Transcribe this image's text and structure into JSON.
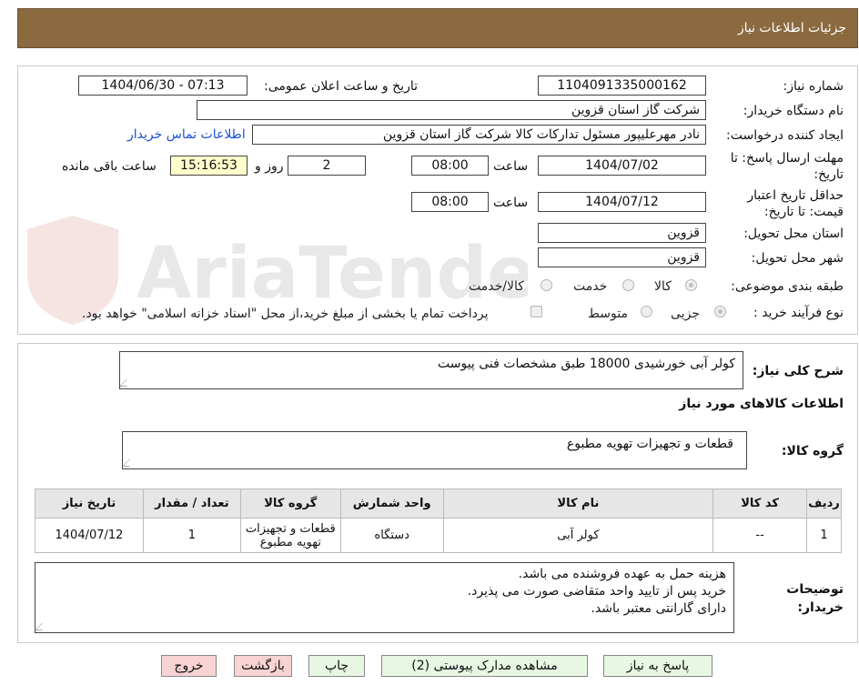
{
  "header": {
    "title": "جزئیات اطلاعات نیاز"
  },
  "watermark": "AriaTender.neT",
  "form": {
    "need_number_label": "شماره نیاز:",
    "need_number": "1104091335000162",
    "announce_label": "تاریخ و ساعت اعلان عمومی:",
    "announce_value": "1404/06/30 - 07:13",
    "buyer_org_label": "نام دستگاه خریدار:",
    "buyer_org": "شرکت گاز استان قزوین",
    "creator_label": "ایجاد کننده درخواست:",
    "creator": "نادر مهرعلیپور مسئول تدارکات کالا شرکت گاز استان قزوین",
    "contact_link": "اطلاعات تماس خریدار",
    "deadline_label": "مهلت ارسال پاسخ: تا تاریخ:",
    "deadline_date": "1404/07/02",
    "time_label": "ساعت",
    "deadline_time": "08:00",
    "days_value": "2",
    "days_label": "روز و",
    "remaining_time": "15:16:53",
    "remaining_label": "ساعت باقی مانده",
    "validity_label": "حداقل تاریخ اعتبار قیمت: تا تاریخ:",
    "validity_date": "1404/07/12",
    "validity_time": "08:00",
    "province_label": "استان محل تحویل:",
    "province": "قزوین",
    "city_label": "شهر محل تحویل:",
    "city": "قزوین",
    "category_label": "طبقه بندی موضوعی:",
    "category_options": [
      "کالا",
      "خدمت",
      "کالا/خدمت"
    ],
    "process_label": "نوع فرآیند خرید :",
    "process_options": [
      "جزیی",
      "متوسط"
    ],
    "payment_note": "پرداخت تمام یا بخشی از مبلغ خرید،از محل \"اسناد خزانه اسلامی\" خواهد بود."
  },
  "details": {
    "summary_label": "شرح کلی نیاز:",
    "summary": "کولر آبی خورشیدی 18000 طبق مشخصات فنی پیوست",
    "goods_info_title": "اطلاعات کالاهای مورد نیاز",
    "goods_group_label": "گروه کالا:",
    "goods_group": "قطعات و تجهیزات تهویه مطبوع",
    "table": {
      "headers": [
        "ردیف",
        "کد کالا",
        "نام کالا",
        "واحد شمارش",
        "گروه کالا",
        "تعداد / مقدار",
        "تاریخ نیاز"
      ],
      "rows": [
        [
          "1",
          "--",
          "کولر آبی",
          "دستگاه",
          "قطعات و تجهیزات تهویه مطبوع",
          "1",
          "1404/07/12"
        ]
      ]
    },
    "notes_label": "توضیحات خریدار:",
    "notes": [
      "هزینه حمل به عهده فروشنده می باشد.",
      "خرید پس از تایید واحد متقاضی صورت می پذیرد.",
      "دارای گارانتی معتبر باشد."
    ]
  },
  "buttons": {
    "reply": "پاسخ به نیاز",
    "attachments": "مشاهده مدارک پیوستی (2)",
    "print": "چاپ",
    "back": "بازگشت",
    "exit": "خروج"
  }
}
